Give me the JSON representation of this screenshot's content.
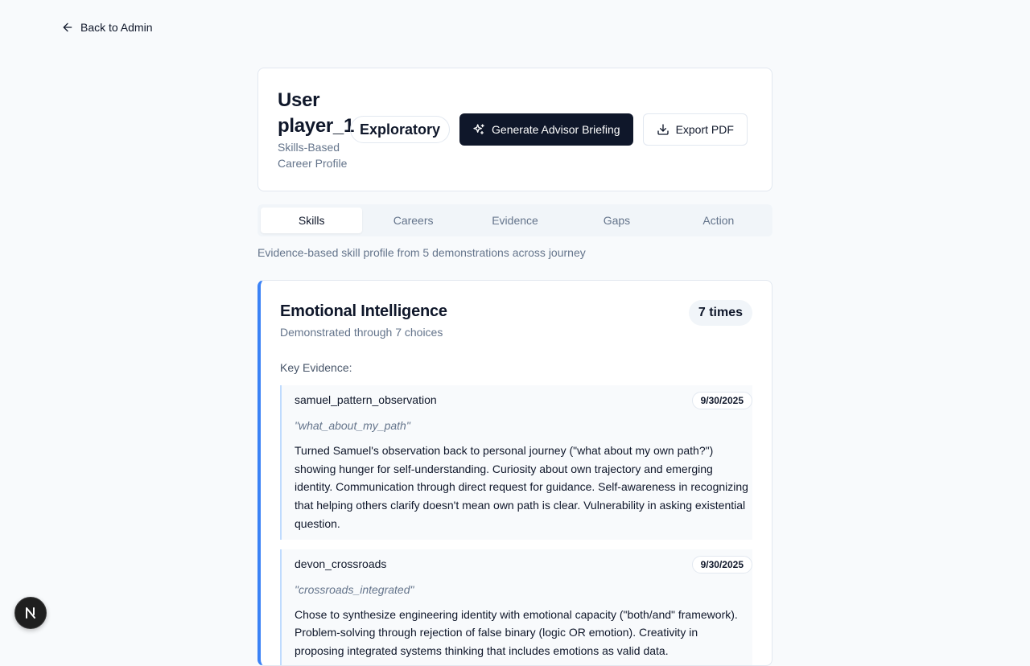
{
  "nav": {
    "back_label": "Back to Admin"
  },
  "header": {
    "title": "User player_1",
    "subtitle": "Skills-Based Career Profile",
    "badge": "Exploratory",
    "generate_label": "Generate Advisor Briefing",
    "export_label": "Export PDF"
  },
  "tabs": [
    {
      "label": "Skills",
      "active": true
    },
    {
      "label": "Careers",
      "active": false
    },
    {
      "label": "Evidence",
      "active": false
    },
    {
      "label": "Gaps",
      "active": false
    },
    {
      "label": "Action",
      "active": false
    }
  ],
  "description": "Evidence-based skill profile from 5 demonstrations across journey",
  "skill": {
    "name": "Emotional Intelligence",
    "subtitle": "Demonstrated through 7 choices",
    "count_badge": "7 times",
    "accent_color": "#3b82f6",
    "key_evidence_label": "Key Evidence:",
    "evidence": [
      {
        "name": "samuel_pattern_observation",
        "date": "9/30/2025",
        "quote": "\"what_about_my_path\"",
        "body": "Turned Samuel's observation back to personal journey (\"what about my own path?\") showing hunger for self-understanding. Curiosity about own trajectory and emerging identity. Communication through direct request for guidance. Self-awareness in recognizing that helping others clarify doesn't mean own path is clear. Vulnerability in asking existential question."
      },
      {
        "name": "devon_crossroads",
        "date": "9/30/2025",
        "quote": "\"crossroads_integrated\"",
        "body": "Chose to synthesize engineering identity with emotional capacity (\"both/and\" framework). Problem-solving through rejection of false binary (logic OR emotion). Creativity in proposing integrated systems thinking that includes emotions as valid data."
      }
    ]
  },
  "dev_badge": "N"
}
